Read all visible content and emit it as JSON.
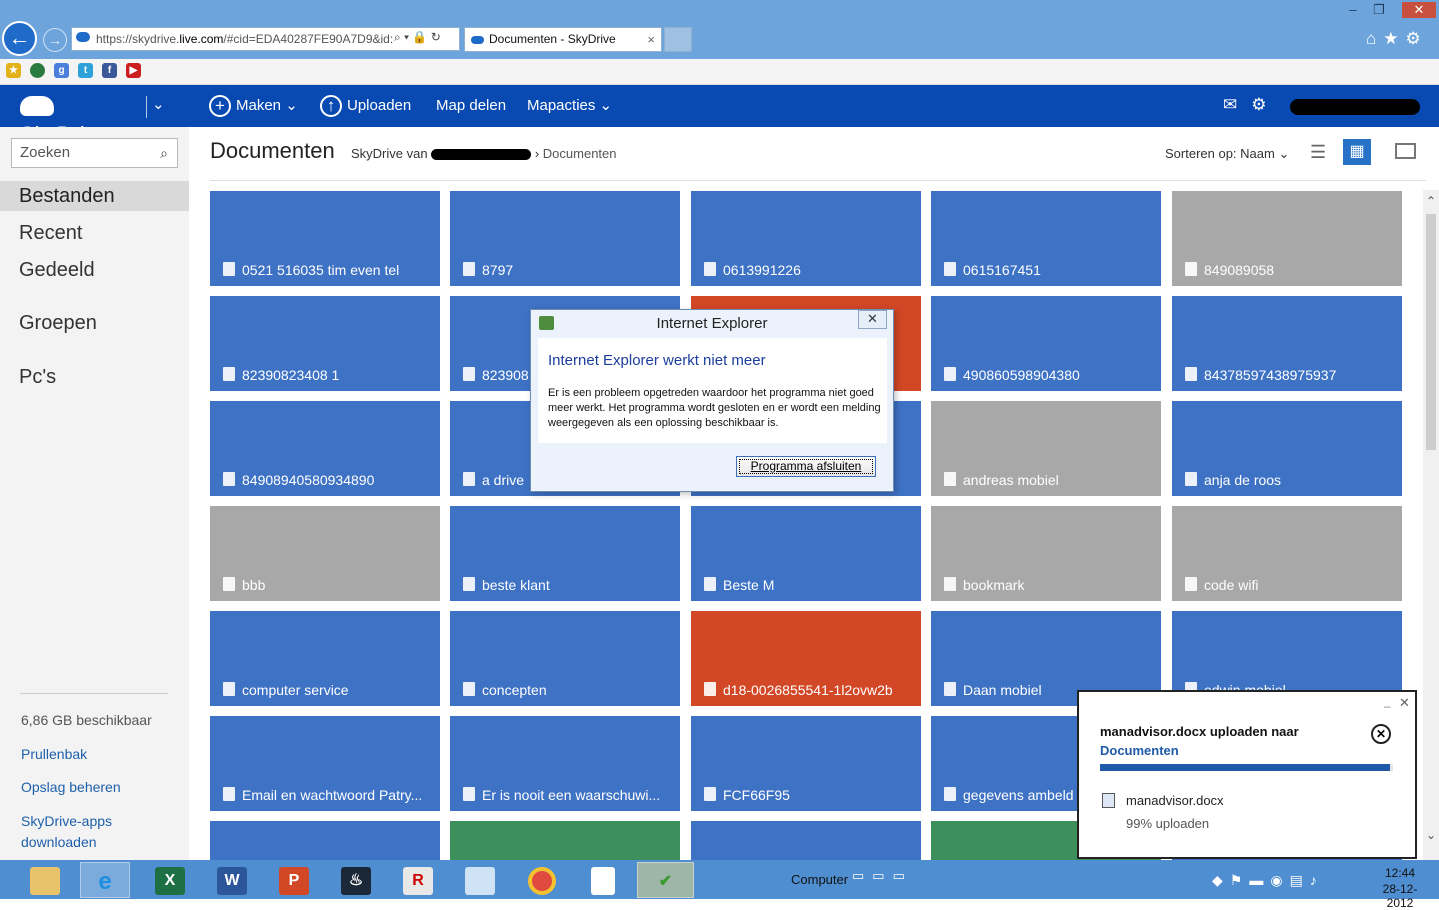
{
  "browser": {
    "url_prefix": "https://skydrive.",
    "url_domain": "live.com",
    "url_rest": "/#cid=EDA40287FE90A7D9&id:",
    "tab_title": "Documenten - SkyDrive",
    "tab_close": "×",
    "window_controls": [
      "–",
      "❐",
      "✕"
    ],
    "addr_icons": "⌕ ▾ 🔒 ↻"
  },
  "skydrive": {
    "logo_text": "SkyDrive",
    "menu": {
      "create": "Maken",
      "upload": "Uploaden",
      "share_folder": "Map delen",
      "folder_actions": "Mapacties"
    }
  },
  "sidebar": {
    "search_placeholder": "Zoeken",
    "nav": [
      "Bestanden",
      "Recent",
      "Gedeeld",
      "Groepen",
      "Pc's"
    ],
    "storage": "6,86 GB beschikbaar",
    "links": [
      "Prullenbak",
      "Opslag beheren",
      "SkyDrive-apps downloaden"
    ]
  },
  "main": {
    "title": "Documenten",
    "breadcrumb_root": "SkyDrive van",
    "breadcrumb_current": "Documenten",
    "sort": "Sorteren op: Naam"
  },
  "tiles": [
    {
      "label": "0521 516035 tim even tel",
      "color": "blue"
    },
    {
      "label": "8797",
      "color": "blue"
    },
    {
      "label": "0613991226",
      "color": "blue"
    },
    {
      "label": "0615167451",
      "color": "blue"
    },
    {
      "label": "849089058",
      "color": "grey"
    },
    {
      "label": "82390823408 1",
      "color": "blue"
    },
    {
      "label": "823908",
      "color": "blue"
    },
    {
      "label": "",
      "color": "orange"
    },
    {
      "label": "490860598904380",
      "color": "blue"
    },
    {
      "label": "84378597438975937",
      "color": "blue"
    },
    {
      "label": "84908940580934890",
      "color": "blue"
    },
    {
      "label": "a drive",
      "color": "blue"
    },
    {
      "label": "",
      "color": "blue"
    },
    {
      "label": "andreas mobiel",
      "color": "grey"
    },
    {
      "label": "anja de roos",
      "color": "blue"
    },
    {
      "label": "bbb",
      "color": "grey"
    },
    {
      "label": "beste klant",
      "color": "blue"
    },
    {
      "label": "Beste M",
      "color": "blue"
    },
    {
      "label": "bookmark",
      "color": "grey"
    },
    {
      "label": "code wifi",
      "color": "grey"
    },
    {
      "label": "computer service",
      "color": "blue"
    },
    {
      "label": "concepten",
      "color": "blue"
    },
    {
      "label": "d18-0026855541-1l2ovw2b",
      "color": "orange"
    },
    {
      "label": "Daan mobiel",
      "color": "blue"
    },
    {
      "label": "edwin mobiel",
      "color": "blue"
    },
    {
      "label": "Email en wachtwoord Patry...",
      "color": "blue"
    },
    {
      "label": "Er is nooit een waarschuwi...",
      "color": "blue"
    },
    {
      "label": "FCF66F95",
      "color": "blue"
    },
    {
      "label": "gegevens ambeld",
      "color": "blue"
    },
    {
      "label": "",
      "color": "blue"
    },
    {
      "label": "",
      "color": "blue"
    },
    {
      "label": "",
      "color": "green"
    },
    {
      "label": "",
      "color": "blue"
    },
    {
      "label": "",
      "color": "green"
    },
    {
      "label": "",
      "color": "blue"
    }
  ],
  "dialog": {
    "title": "Internet Explorer",
    "close": "✕",
    "heading": "Internet Explorer werkt niet meer",
    "message": "Er is een probleem opgetreden waardoor het programma niet goed meer werkt. Het programma wordt gesloten en er wordt een melding weergegeven als een oplossing beschikbaar is.",
    "button": "Programma afsluiten"
  },
  "upload": {
    "title": "manadvisor.docx uploaden naar",
    "destination": "Documenten",
    "filename": "manadvisor.docx",
    "status": "99% uploaden",
    "progress": 0.99
  },
  "taskbar": {
    "computer_label": "Computer",
    "time": "12:44",
    "date": "28-12-2012"
  },
  "colors": {
    "header_blue": "#094ab2",
    "tile_blue": "#3e72c4",
    "tile_grey": "#a8a8a8",
    "tile_orange": "#d24726",
    "tile_green": "#3d8f5c",
    "taskbar": "#4f8ed0"
  }
}
